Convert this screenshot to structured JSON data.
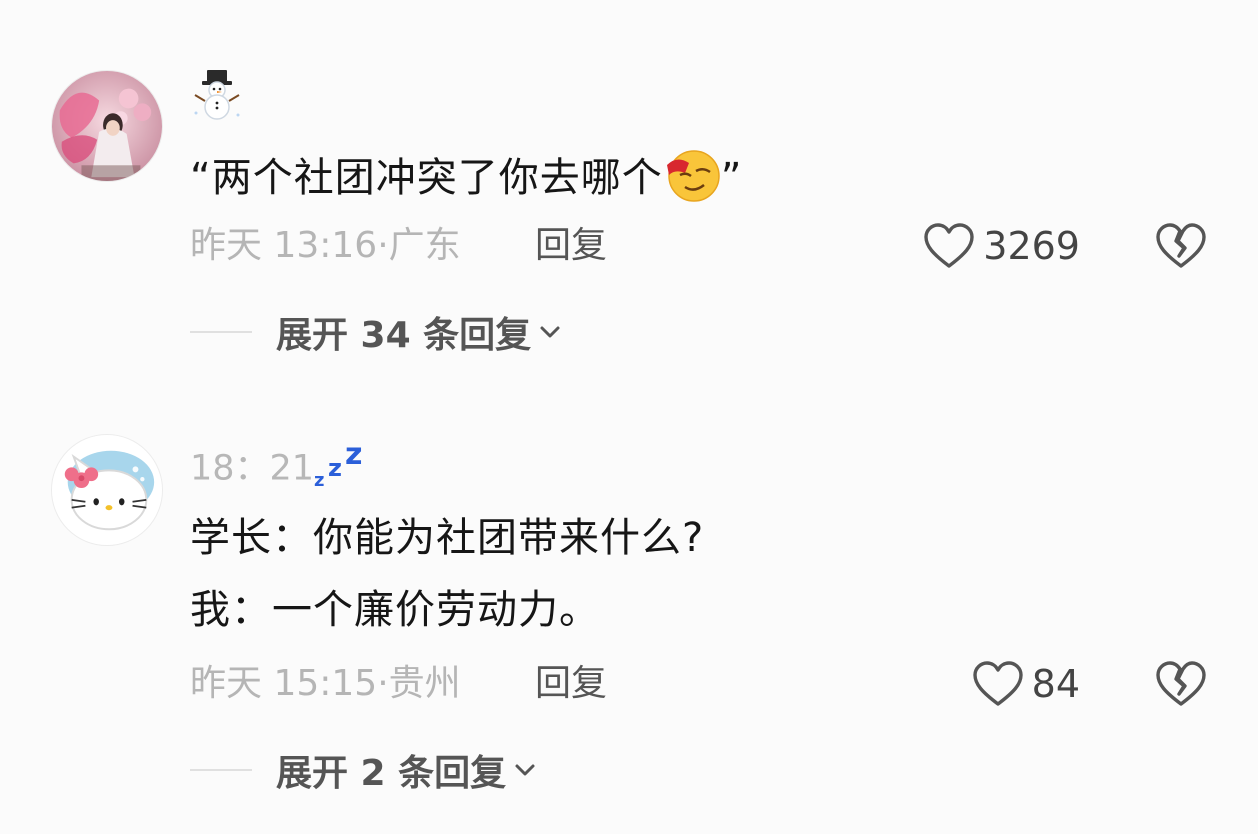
{
  "comments": [
    {
      "avatar": "pink-butterfly-portrait-avatar",
      "username_emoji": "snowman-icon",
      "text_lines": [
        "“两个社团冲突了你去哪个",
        "”"
      ],
      "text_emoji": "wink-face-emoji",
      "time": "昨天 13:16",
      "location": "广东",
      "reply_label": "回复",
      "likes": "3269",
      "expand_label": "展开 34 条回复"
    },
    {
      "avatar": "hello-kitty-avatar",
      "username": "18：21",
      "username_emoji": "zzz-sleep-icon",
      "text_lines": [
        "学长：你能为社团带来什么?",
        "我：一个廉价劳动力。"
      ],
      "time": "昨天 15:15",
      "location": "贵州",
      "reply_label": "回复",
      "likes": "84",
      "expand_label": "展开 2 条回复"
    }
  ],
  "colors": {
    "background": "#fbfbfb",
    "text_primary": "#161616",
    "text_secondary": "#b5b5b5",
    "action": "#555555",
    "zzz_blue": "#2b5fd9"
  }
}
